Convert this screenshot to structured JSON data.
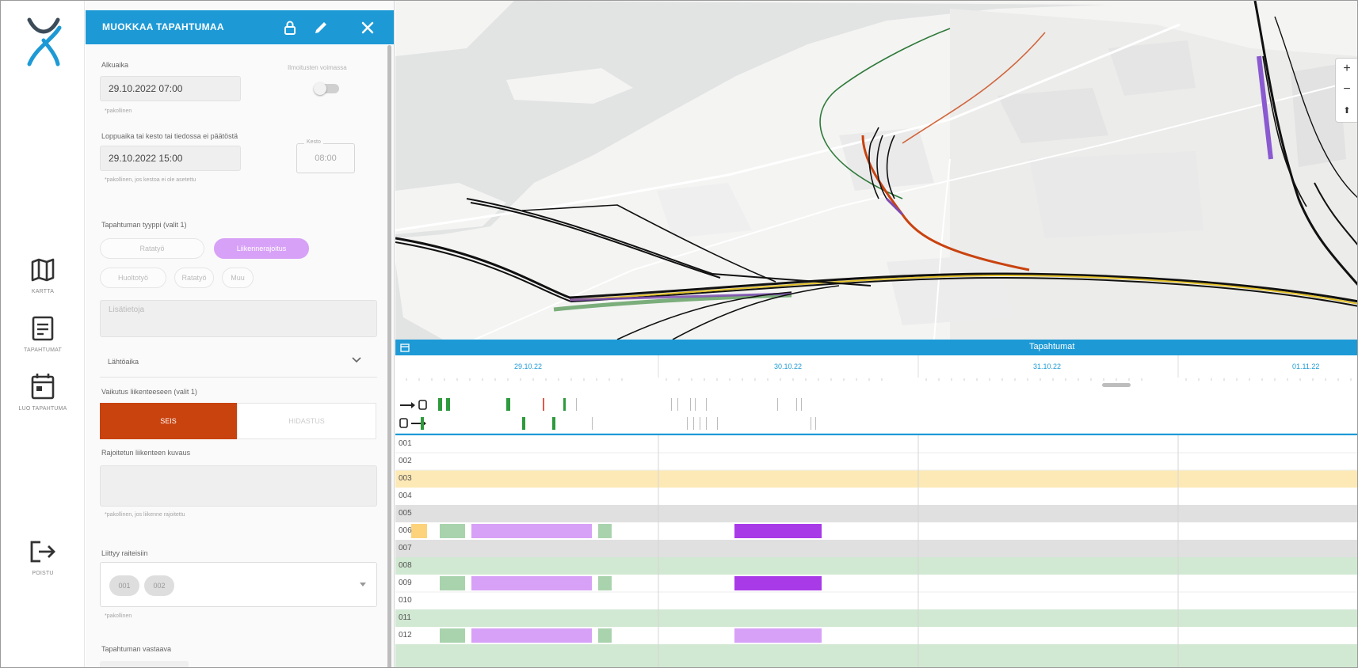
{
  "rail": {
    "nav": [
      {
        "label": "KARTTA",
        "icon": "map-icon"
      },
      {
        "label": "TAPAHTUMAT",
        "icon": "events-icon"
      },
      {
        "label": "LUO TAPAHTUMA",
        "icon": "calendar-icon"
      },
      {
        "label": "POISTU",
        "icon": "logout-icon"
      }
    ]
  },
  "panel": {
    "title": "MUOKKAA TAPAHTUMAA",
    "start_label": "Alkuaika",
    "start_value": "29.10.2022 07:00",
    "start_hint": "*pakollinen",
    "toggle_label": "Ilmoitusten voimassa",
    "end_label": "Loppuaika tai kesto tai tiedossa ei päätöstä",
    "end_value": "29.10.2022 15:00",
    "end_hint": "*pakollinen, jos kestoa ei ole asetettu",
    "duration_label": "Kesto",
    "duration_value": "08:00",
    "type_label": "Tapahtuman tyyppi (valit 1)",
    "type_options": [
      "Ratatyö",
      "Liikennerajoitus",
      "Huoltotyö",
      "Ratatyö",
      "Muu"
    ],
    "notes_placeholder": "Lisätietoja",
    "dropdown_label": "Lähtöaika",
    "effect_label": "Vaikutus liikenteeseen (valit 1)",
    "effect_options": [
      "SEIS",
      "HIDASTUS"
    ],
    "desc_label": "Rajoitetun liikenteen kuvaus",
    "desc_hint": "*pakollinen, jos liikenne rajoitettu",
    "tracks_label": "Liittyy raiteisiin",
    "tracks_chips": [
      "001",
      "002"
    ],
    "tracks_hint": "*pakollinen",
    "last_label": "Tapahtuman vastaava"
  },
  "map": {
    "zoom_in": "+",
    "zoom_out": "−",
    "north": "⬆"
  },
  "timeline": {
    "title": "Tapahtumat",
    "dates": [
      "29.10.22",
      "30.10.22",
      "31.10.22",
      "01.11.22"
    ],
    "rows": [
      "001",
      "002",
      "003",
      "004",
      "005",
      "006",
      "007",
      "008",
      "009",
      "010",
      "011",
      "012"
    ]
  },
  "colors": {
    "primary": "#1d9ad6",
    "stop": "#c9430f",
    "purple_light": "#d7a1f7",
    "purple_dark": "#a83ae8",
    "green_light": "#a9d3ad",
    "green_row": "#d1e8d2",
    "yellow_row": "#fde9b5",
    "grey_row": "#e0e0e0"
  }
}
